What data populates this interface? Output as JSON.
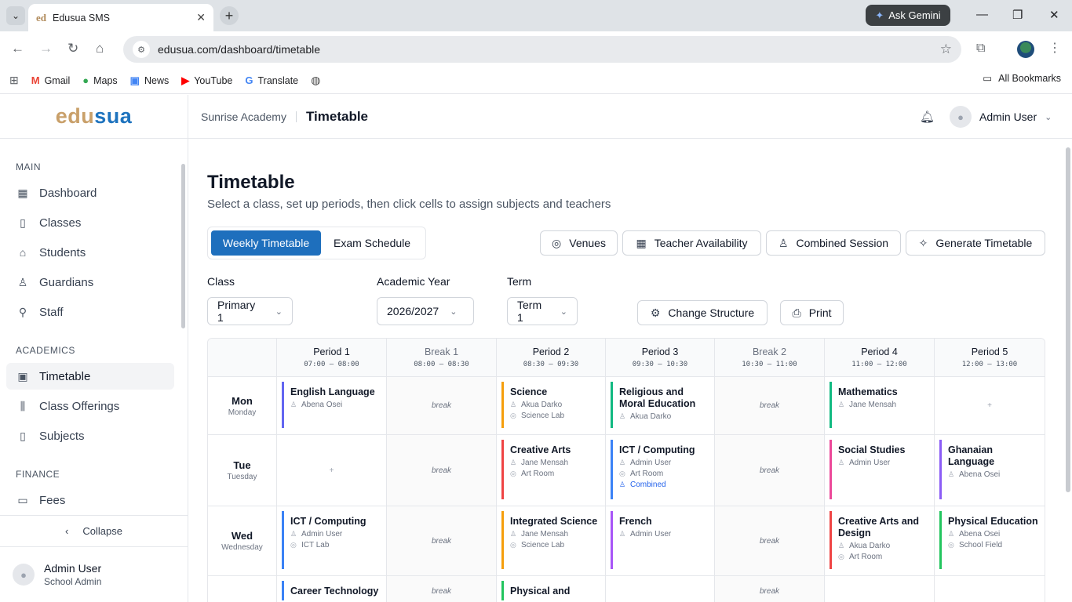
{
  "browser": {
    "tab_favicon_a": "ed",
    "tab_title": "Edusua SMS",
    "ask_gemini": "Ask Gemini",
    "url": "edusua.com/dashboard/timetable",
    "bookmarks": [
      "Gmail",
      "Maps",
      "News",
      "YouTube",
      "Translate"
    ],
    "all_bookmarks": "All Bookmarks"
  },
  "brand": {
    "part1": "edu",
    "part2": "sua",
    "color1": "#c9a06a",
    "color2": "#1e73be"
  },
  "sidebar": {
    "sections": [
      {
        "title": "MAIN",
        "items": [
          {
            "label": "Dashboard",
            "icon": "grid-icon"
          },
          {
            "label": "Classes",
            "icon": "book-icon"
          },
          {
            "label": "Students",
            "icon": "graduation-cap-icon"
          },
          {
            "label": "Guardians",
            "icon": "users-icon"
          },
          {
            "label": "Staff",
            "icon": "user-cog-icon"
          }
        ]
      },
      {
        "title": "ACADEMICS",
        "items": [
          {
            "label": "Timetable",
            "icon": "calendar-icon",
            "active": true
          },
          {
            "label": "Class Offerings",
            "icon": "library-icon"
          },
          {
            "label": "Subjects",
            "icon": "book-open-icon"
          }
        ]
      },
      {
        "title": "FINANCE",
        "items": [
          {
            "label": "Fees",
            "icon": "credit-card-icon"
          }
        ]
      }
    ],
    "collapse": "Collapse",
    "user_name": "Admin User",
    "user_role": "School Admin"
  },
  "topbar": {
    "school": "Sunrise Academy",
    "page": "Timetable",
    "user": "Admin User"
  },
  "main": {
    "title": "Timetable",
    "subtitle": "Select a class, set up periods, then click cells to assign subjects and teachers",
    "tabs": [
      "Weekly Timetable",
      "Exam Schedule"
    ],
    "actions": [
      "Venues",
      "Teacher Availability",
      "Combined Session",
      "Generate Timetable"
    ],
    "filters": {
      "class_label": "Class",
      "class_value": "Primary 1",
      "year_label": "Academic Year",
      "year_value": "2026/2027",
      "term_label": "Term",
      "term_value": "Term 1"
    },
    "change_structure": "Change Structure",
    "print": "Print"
  },
  "timetable": {
    "break_text": "break",
    "empty_text": "+",
    "columns": [
      {
        "name": "Period 1",
        "time": "07:00 – 08:00",
        "break": false
      },
      {
        "name": "Break 1",
        "time": "08:00 – 08:30",
        "break": true
      },
      {
        "name": "Period 2",
        "time": "08:30 – 09:30",
        "break": false
      },
      {
        "name": "Period 3",
        "time": "09:30 – 10:30",
        "break": false
      },
      {
        "name": "Break 2",
        "time": "10:30 – 11:00",
        "break": true
      },
      {
        "name": "Period 4",
        "time": "11:00 – 12:00",
        "break": false
      },
      {
        "name": "Period 5",
        "time": "12:00 – 13:00",
        "break": false
      }
    ],
    "rows": [
      {
        "short": "Mon",
        "long": "Monday",
        "cells": [
          {
            "subject": "English Language",
            "teacher": "Abena Osei",
            "color": "#6366f1"
          },
          null,
          {
            "subject": "Science",
            "teacher": "Akua Darko",
            "room": "Science Lab",
            "color": "#f59e0b"
          },
          {
            "subject": "Religious and Moral Education",
            "teacher": "Akua Darko",
            "color": "#10b981"
          },
          null,
          {
            "subject": "Mathematics",
            "teacher": "Jane Mensah",
            "color": "#10b981"
          },
          {}
        ]
      },
      {
        "short": "Tue",
        "long": "Tuesday",
        "cells": [
          {},
          null,
          {
            "subject": "Creative Arts",
            "teacher": "Jane Mensah",
            "room": "Art Room",
            "color": "#ef4444"
          },
          {
            "subject": "ICT / Computing",
            "teacher": "Admin User",
            "room": "Art Room",
            "combined": "Combined",
            "color": "#3b82f6"
          },
          null,
          {
            "subject": "Social Studies",
            "teacher": "Admin User",
            "color": "#ec4899"
          },
          {
            "subject": "Ghanaian Language",
            "teacher": "Abena Osei",
            "color": "#8b5cf6"
          }
        ]
      },
      {
        "short": "Wed",
        "long": "Wednesday",
        "cells": [
          {
            "subject": "ICT / Computing",
            "teacher": "Admin User",
            "room": "ICT Lab",
            "color": "#3b82f6"
          },
          null,
          {
            "subject": "Integrated Science",
            "teacher": "Jane Mensah",
            "room": "Science Lab",
            "color": "#f59e0b"
          },
          {
            "subject": "French",
            "teacher": "Admin User",
            "color": "#a855f7"
          },
          null,
          {
            "subject": "Creative Arts and Design",
            "teacher": "Akua Darko",
            "room": "Art Room",
            "color": "#ef4444"
          },
          {
            "subject": "Physical Education",
            "teacher": "Abena Osei",
            "room": "School Field",
            "color": "#22c55e"
          }
        ]
      },
      {
        "short": "",
        "long": "",
        "cells": [
          {
            "subject": "Career Technology",
            "color": "#3b82f6"
          },
          null,
          {
            "subject": "Physical and",
            "color": "#22c55e"
          },
          {},
          null,
          {},
          {}
        ]
      }
    ]
  }
}
